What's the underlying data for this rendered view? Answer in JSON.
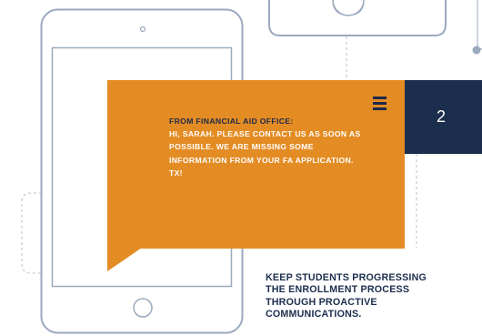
{
  "message": {
    "from": "FROM FINANCIAL AID OFFICE:",
    "body": "HI, SARAH. PLEASE CONTACT US AS SOON AS POSSIBLE. WE ARE MISSING SOME INFORMATION FROM YOUR FA APPLICATION. TX!"
  },
  "step": {
    "number": "2"
  },
  "caption": {
    "lines": [
      "KEEP STUDENTS PROGRESSING",
      "THE ENROLLMENT PROCESS",
      "THROUGH PROACTIVE",
      "COMMUNICATIONS."
    ]
  },
  "colors": {
    "bubble": "#E48C24",
    "navy": "#1C2E4D",
    "outline": "#9AA9BE",
    "dashed": "#B7C2D1"
  },
  "icons": [
    "phone-outline-icon",
    "home-button-icon",
    "camera-dot-icon",
    "menu-icon",
    "connector-dot-icon"
  ]
}
